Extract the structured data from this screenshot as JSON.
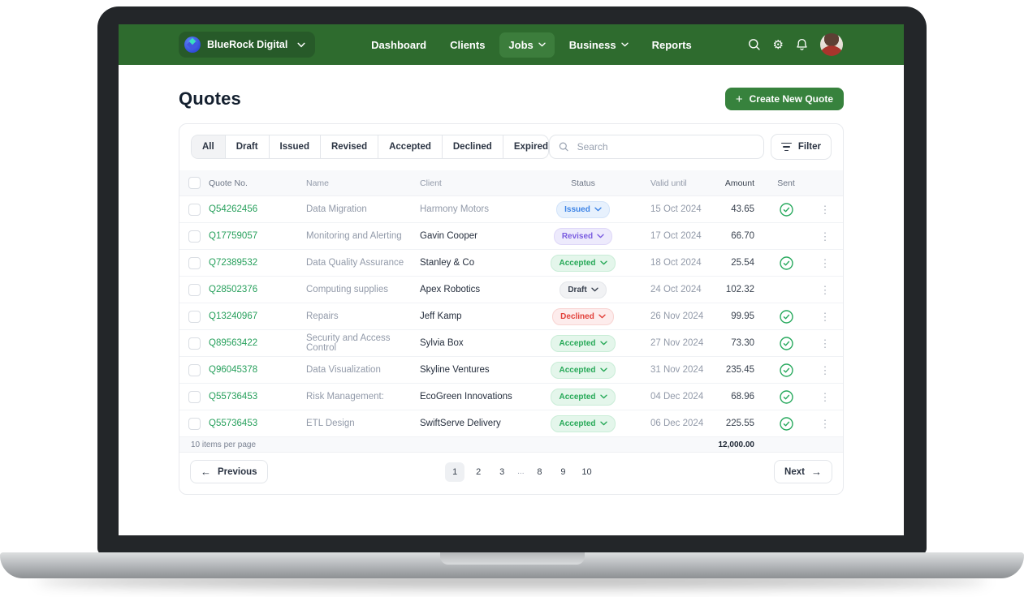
{
  "brand": {
    "name": "BlueRock Digital"
  },
  "nav": {
    "items": [
      {
        "label": "Dashboard",
        "active": false,
        "has_dropdown": false
      },
      {
        "label": "Clients",
        "active": false,
        "has_dropdown": false
      },
      {
        "label": "Jobs",
        "active": true,
        "has_dropdown": true
      },
      {
        "label": "Business",
        "active": false,
        "has_dropdown": true
      },
      {
        "label": "Reports",
        "active": false,
        "has_dropdown": false
      }
    ]
  },
  "page": {
    "title": "Quotes",
    "create_button": "Create New Quote"
  },
  "tabs": {
    "items": [
      "All",
      "Draft",
      "Issued",
      "Revised",
      "Accepted",
      "Declined",
      "Expired"
    ],
    "active": "All"
  },
  "search": {
    "placeholder": "Search"
  },
  "filter_label": "Filter",
  "table": {
    "columns": [
      "Quote No.",
      "Name",
      "Client",
      "Status",
      "Valid until",
      "Amount",
      "Sent"
    ],
    "rows": [
      {
        "quote_no": "Q54262456",
        "name": "Data Migration",
        "client": "Harmony Motors",
        "client_dark": false,
        "status": "Issued",
        "valid_until": "15 Oct 2024",
        "amount": "43.65",
        "sent": true
      },
      {
        "quote_no": "Q17759057",
        "name": "Monitoring and Alerting",
        "client": "Gavin Cooper",
        "client_dark": true,
        "status": "Revised",
        "valid_until": "17 Oct 2024",
        "amount": "66.70",
        "sent": false
      },
      {
        "quote_no": "Q72389532",
        "name": "Data Quality Assurance",
        "client": "Stanley & Co",
        "client_dark": true,
        "status": "Accepted",
        "valid_until": "18 Oct 2024",
        "amount": "25.54",
        "sent": true
      },
      {
        "quote_no": "Q28502376",
        "name": "Computing supplies",
        "client": "Apex Robotics",
        "client_dark": true,
        "status": "Draft",
        "valid_until": "24 Oct 2024",
        "amount": "102.32",
        "sent": false
      },
      {
        "quote_no": "Q13240967",
        "name": "Repairs",
        "client": "Jeff Kamp",
        "client_dark": true,
        "status": "Declined",
        "valid_until": "26 Nov 2024",
        "amount": "99.95",
        "sent": true
      },
      {
        "quote_no": "Q89563422",
        "name": "Security and Access Control",
        "client": "Sylvia Box",
        "client_dark": true,
        "status": "Accepted",
        "valid_until": "27 Nov 2024",
        "amount": "73.30",
        "sent": true
      },
      {
        "quote_no": "Q96045378",
        "name": "Data Visualization",
        "client": "Skyline Ventures",
        "client_dark": true,
        "status": "Accepted",
        "valid_until": "31 Nov 2024",
        "amount": "235.45",
        "sent": true
      },
      {
        "quote_no": "Q55736453",
        "name": "Risk Management:",
        "client": "EcoGreen Innovations",
        "client_dark": true,
        "status": "Accepted",
        "valid_until": "04 Dec 2024",
        "amount": "68.96",
        "sent": true
      },
      {
        "quote_no": "Q55736453",
        "name": "ETL Design",
        "client": "SwiftServe Delivery",
        "client_dark": true,
        "status": "Accepted",
        "valid_until": "06 Dec 2024",
        "amount": "225.55",
        "sent": true
      }
    ]
  },
  "footer": {
    "items_per_page": "10 items per page",
    "total": "12,000.00"
  },
  "pagination": {
    "previous": "Previous",
    "next": "Next",
    "pages": [
      "1",
      "2",
      "3",
      "...",
      "8",
      "9",
      "10"
    ],
    "active": "1"
  },
  "colors": {
    "navbar_green": "#2e6b2e",
    "navbar_active_green": "#3c7d3c",
    "brand_chip_green": "#275a29",
    "accent_green": "#27a95d",
    "link_green": "#27a05c",
    "button_green": "#37823d",
    "status_styles": {
      "issued": {
        "bg": "#e7f1fd",
        "text": "#3c83e6",
        "border": "#d3e4fa"
      },
      "revised": {
        "bg": "#edeafc",
        "text": "#7a5ce0",
        "border": "#ded7f8"
      },
      "accepted": {
        "bg": "#e4f6eb",
        "text": "#27a958",
        "border": "#c9edd7"
      },
      "draft": {
        "bg": "#f1f2f4",
        "text": "#39414f",
        "border": "#e4e6ea"
      },
      "declined": {
        "bg": "#fdecec",
        "text": "#e2403a",
        "border": "#f8d4d2"
      }
    }
  }
}
